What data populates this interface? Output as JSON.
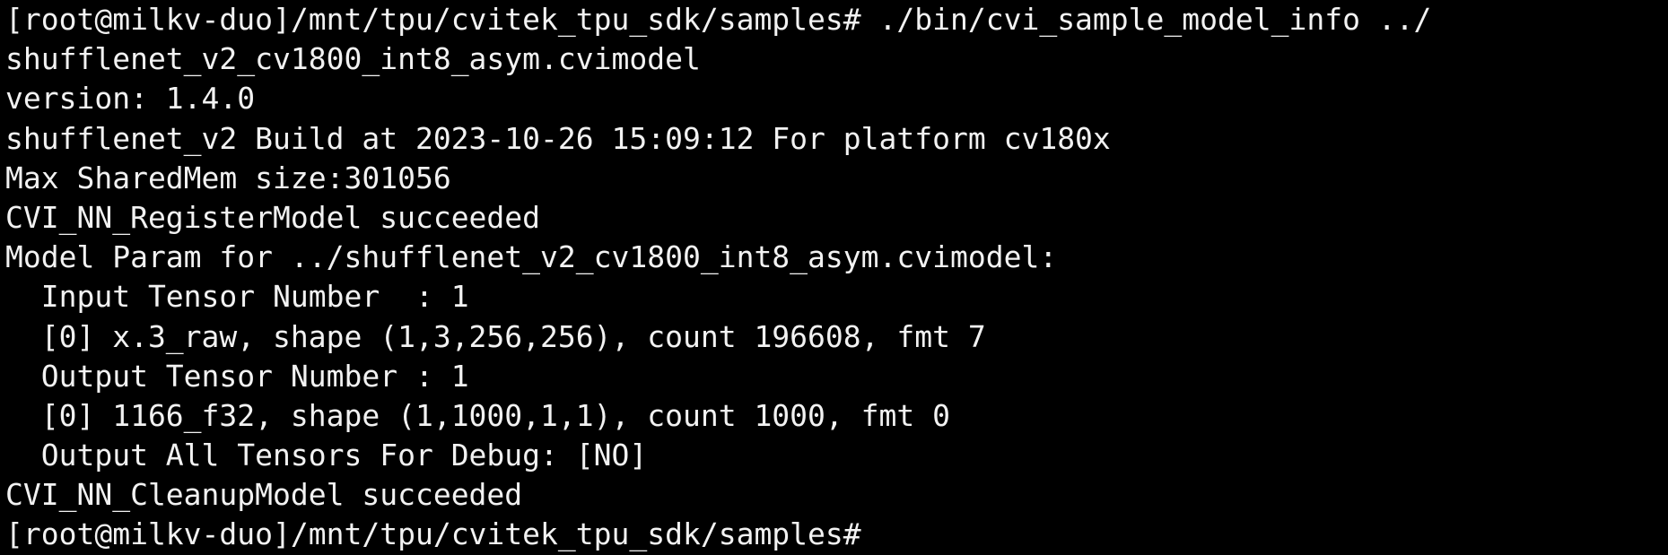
{
  "terminal": {
    "lines": [
      "[root@milkv-duo]/mnt/tpu/cvitek_tpu_sdk/samples# ./bin/cvi_sample_model_info ../",
      "shufflenet_v2_cv1800_int8_asym.cvimodel",
      "version: 1.4.0",
      "shufflenet_v2 Build at 2023-10-26 15:09:12 For platform cv180x",
      "Max SharedMem size:301056",
      "CVI_NN_RegisterModel succeeded",
      "Model Param for ../shufflenet_v2_cv1800_int8_asym.cvimodel:",
      "  Input Tensor Number  : 1",
      "  [0] x.3_raw, shape (1,3,256,256), count 196608, fmt 7",
      "  Output Tensor Number : 1",
      "  [0] 1166_f32, shape (1,1000,1,1), count 1000, fmt 0",
      "  Output All Tensors For Debug: [NO]",
      "CVI_NN_CleanupModel succeeded",
      "[root@milkv-duo]/mnt/tpu/cvitek_tpu_sdk/samples#"
    ]
  },
  "colors": {
    "background": "#000000",
    "foreground": "#f2f2f2"
  }
}
